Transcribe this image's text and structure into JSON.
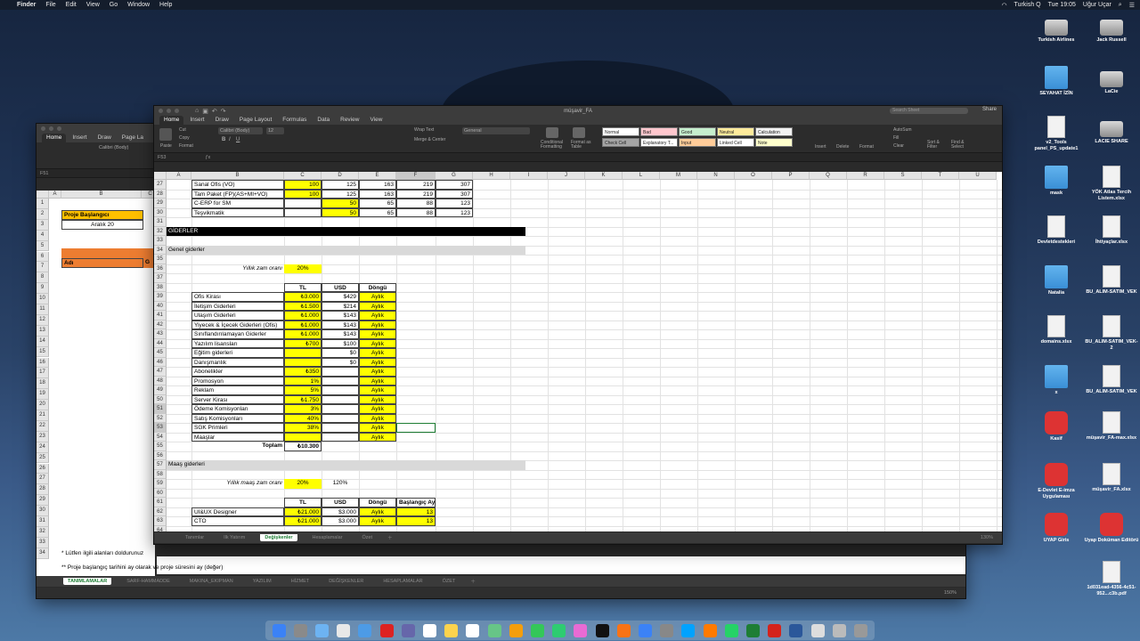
{
  "menubar": {
    "app": "Finder",
    "items": [
      "File",
      "Edit",
      "View",
      "Go",
      "Window",
      "Help"
    ],
    "right": {
      "locale": "Turkish Q",
      "time": "Tue 19:05",
      "user": "Uğur Uçar"
    }
  },
  "desktop_icons": [
    {
      "label": "Turkish Airlines",
      "kind": "drive"
    },
    {
      "label": "Jack Russell",
      "kind": "drive"
    },
    {
      "label": "SEYAHAT İZİN",
      "kind": "folder"
    },
    {
      "label": "LaCie",
      "kind": "drive"
    },
    {
      "label": "v2_Tools panel_PS_update1",
      "kind": "doc"
    },
    {
      "label": "LACIE SHARE",
      "kind": "drive"
    },
    {
      "label": "mask",
      "kind": "folder"
    },
    {
      "label": "YÖK Atlas Tercih Listem.xlsx",
      "kind": "doc"
    },
    {
      "label": "Devletdestekleri",
      "kind": "doc"
    },
    {
      "label": "İhtiyaçlar.xlsx",
      "kind": "doc"
    },
    {
      "label": "Natalia",
      "kind": "folder"
    },
    {
      "label": "BU_ALIM-SATIM_VEK",
      "kind": "doc"
    },
    {
      "label": "domains.xlsx",
      "kind": "doc"
    },
    {
      "label": "BU_ALIM-SATIM_VEK-2",
      "kind": "doc"
    },
    {
      "label": "x",
      "kind": "folder"
    },
    {
      "label": "BU_ALIM-SATIM_VEK",
      "kind": "doc"
    },
    {
      "label": "Kasif",
      "kind": "app"
    },
    {
      "label": "müşavir_FA-max.xlsx",
      "kind": "doc"
    },
    {
      "label": "E-Devlet E-imza Uygulaması",
      "kind": "app"
    },
    {
      "label": "müşavir_FA.xlsx",
      "kind": "doc"
    },
    {
      "label": "UYAP Giris",
      "kind": "app"
    },
    {
      "label": "Uyap Doküman Editörü",
      "kind": "app"
    },
    {
      "label": "1d031ead-4356-4c51-952...c3b.pdf",
      "kind": "doc"
    }
  ],
  "back_window": {
    "tabs": [
      "Home",
      "Insert",
      "Draw",
      "Page La"
    ],
    "font": "Calibri (Body)",
    "namebox": "F51",
    "cols": [
      "A",
      "B",
      "C"
    ],
    "rows": [
      "1",
      "2",
      "3",
      "4",
      "5",
      "6",
      "7",
      "8",
      "9",
      "10",
      "11",
      "12",
      "13",
      "14",
      "15",
      "16",
      "17",
      "18",
      "19",
      "20",
      "21",
      "22",
      "23",
      "24",
      "25",
      "26",
      "27",
      "28",
      "29",
      "30",
      "31",
      "32",
      "33",
      "34"
    ],
    "cells": {
      "proje": "Proje Başlangıcı",
      "aralik": "Aralık 20",
      "adi": "Adı",
      "g": "G"
    },
    "note1": "* Lütfen ilgili alanları doldurunuz",
    "note2": "** Proje başlangıç tarihini ay olarak ve proje süresini ay (değer)",
    "sheet_tabs": [
      "TANIMLAMALAR",
      "SARF-HAMMADDE",
      "MAKINA_EKIPMAN",
      "YAZILIM",
      "HİZMET",
      "DEĞİŞKENLER",
      "HESAPLAMALAR",
      "ÖZET"
    ],
    "zoom": "150%"
  },
  "front_window": {
    "title": "müşavir_FA",
    "search": "Search Sheet",
    "share": "Share",
    "tabs": [
      "Home",
      "Insert",
      "Draw",
      "Page Layout",
      "Formulas",
      "Data",
      "Review",
      "View"
    ],
    "ribbon": {
      "cut": "Cut",
      "copy": "Copy",
      "format": "Format",
      "paste": "Paste",
      "font": "Calibri (Body)",
      "size": "12",
      "wrap": "Wrap Text",
      "merge": "Merge & Center",
      "number": "General",
      "cond": "Conditional Formatting",
      "fmt_table": "Format as Table",
      "styles": [
        {
          "label": "Normal",
          "color": "#ffffff"
        },
        {
          "label": "Bad",
          "color": "#ffc7ce"
        },
        {
          "label": "Good",
          "color": "#c6efce"
        },
        {
          "label": "Neutral",
          "color": "#ffeb9c"
        },
        {
          "label": "Calculation",
          "color": "#f2f2f2"
        },
        {
          "label": "Check Cell",
          "color": "#a5a5a5"
        },
        {
          "label": "Explanatory T...",
          "color": "#ffffff"
        },
        {
          "label": "Input",
          "color": "#ffcc99"
        },
        {
          "label": "Linked Cell",
          "color": "#ffffff"
        },
        {
          "label": "Note",
          "color": "#ffffcc"
        }
      ],
      "insert": "Insert",
      "delete": "Delete",
      "format2": "Format",
      "autosum": "AutoSum",
      "fill": "Fill",
      "clear": "Clear",
      "sort": "Sort & Filter",
      "find": "Find & Select"
    },
    "namebox": "F53",
    "cols": [
      "A",
      "B",
      "C",
      "D",
      "E",
      "F",
      "G",
      "H",
      "I",
      "J",
      "K",
      "L",
      "M",
      "N",
      "O",
      "P",
      "Q",
      "R",
      "S",
      "T",
      "U"
    ],
    "rows": [
      "27",
      "28",
      "29",
      "30",
      "31",
      "32",
      "33",
      "34",
      "35",
      "36",
      "37",
      "38",
      "39",
      "40",
      "41",
      "42",
      "43",
      "44",
      "45",
      "46",
      "47",
      "48",
      "49",
      "50",
      "51",
      "52",
      "53",
      "54",
      "55",
      "56",
      "57",
      "58",
      "59",
      "60",
      "61",
      "62",
      "63",
      "64"
    ],
    "top_rows": [
      {
        "b": "Sanal Ofis (VO)",
        "c": "100",
        "d": "125",
        "e": "163",
        "f": "219",
        "g": "307"
      },
      {
        "b": "Tam Paket (FP)(AS+MI+VO)",
        "c": "100",
        "d": "125",
        "e": "163",
        "f": "219",
        "g": "307"
      },
      {
        "b": "C-ERP for SM",
        "c": "",
        "d": "50",
        "e": "65",
        "f": "88",
        "g": "123"
      },
      {
        "b": "Teşvikmatik",
        "c": "",
        "d": "50",
        "e": "65",
        "f": "88",
        "g": "123"
      }
    ],
    "giderler": "GİDERLER",
    "genel": "Genel giderler",
    "yillik_zam_label": "Yıllık zam oranı",
    "yillik_zam": "20%",
    "hdr": {
      "tl": "TL",
      "usd": "USD",
      "dongu": "Döngü",
      "baslangic": "Başlangıç Ayı"
    },
    "expenses": [
      {
        "name": "Ofis Kirası",
        "tl": "₺3.000",
        "usd": "$429",
        "d": "Aylık"
      },
      {
        "name": "İletişim Giderleri",
        "tl": "₺1.500",
        "usd": "$214",
        "d": "Aylık"
      },
      {
        "name": "Ulaşım Giderleri",
        "tl": "₺1.000",
        "usd": "$143",
        "d": "Aylık"
      },
      {
        "name": "Yiyecek & İçecek Giderleri (Ofis)",
        "tl": "₺1.000",
        "usd": "$143",
        "d": "Aylık"
      },
      {
        "name": "Sınıflandırılamayan Giderler",
        "tl": "₺1.000",
        "usd": "$143",
        "d": "Aylık"
      },
      {
        "name": "Yazılım lisansları",
        "tl": "₺700",
        "usd": "$100",
        "d": "Aylık"
      },
      {
        "name": "Eğitim giderleri",
        "tl": "",
        "usd": "$0",
        "d": "Aylık"
      },
      {
        "name": "Danışmanlık",
        "tl": "",
        "usd": "$0",
        "d": "Aylık"
      },
      {
        "name": "Abonelikler",
        "tl": "₺350",
        "usd": "",
        "d": "Aylık"
      },
      {
        "name": "Promosyon",
        "tl": "1%",
        "usd": "",
        "d": "Aylık"
      },
      {
        "name": "Reklam",
        "tl": "5%",
        "usd": "",
        "d": "Aylık"
      },
      {
        "name": "Server Kirası",
        "tl": "₺1.750",
        "usd": "",
        "d": "Aylık"
      },
      {
        "name": "Ödeme Komisyonları",
        "tl": "3%",
        "usd": "",
        "d": "Aylık"
      },
      {
        "name": "Satış Komisyonları",
        "tl": "40%",
        "usd": "",
        "d": "Aylık"
      },
      {
        "name": "SGK Primleri",
        "tl": "38%",
        "usd": "",
        "d": "Aylık"
      },
      {
        "name": "Maaşlar",
        "tl": "",
        "usd": "",
        "d": "Aylık"
      }
    ],
    "toplam_label": "Toplam",
    "toplam": "₺10.300",
    "maas": "Maaş giderleri",
    "maas_zam_label": "Yıllık maaş zam oranı",
    "maas_zam": "20%",
    "maas_zam2": "120%",
    "salaries": [
      {
        "name": "UI&UX Designer",
        "tl": "₺21.000",
        "usd": "$3.000",
        "d": "Aylık",
        "b": "13"
      },
      {
        "name": "CTO",
        "tl": "₺21.000",
        "usd": "$3.000",
        "d": "Aylık",
        "b": "13"
      }
    ],
    "sheet_tabs": [
      "Tanımlar",
      "Ilk Yatırım",
      "Değişkenler",
      "Hesaplamalar",
      "Özet"
    ],
    "zoom": "130%"
  },
  "dock_apps": [
    "finder",
    "launchpad",
    "safari",
    "chrome",
    "mail",
    "opera",
    "preview",
    "calendar",
    "notes",
    "reminders",
    "maps",
    "photos",
    "messages",
    "facetime",
    "itunes",
    "tv",
    "books",
    "appstore",
    "preferences",
    "photoshop",
    "illustrator",
    "whatsapp",
    "excel",
    "acrobat",
    "word",
    "textedit",
    "preview2",
    "trash"
  ]
}
